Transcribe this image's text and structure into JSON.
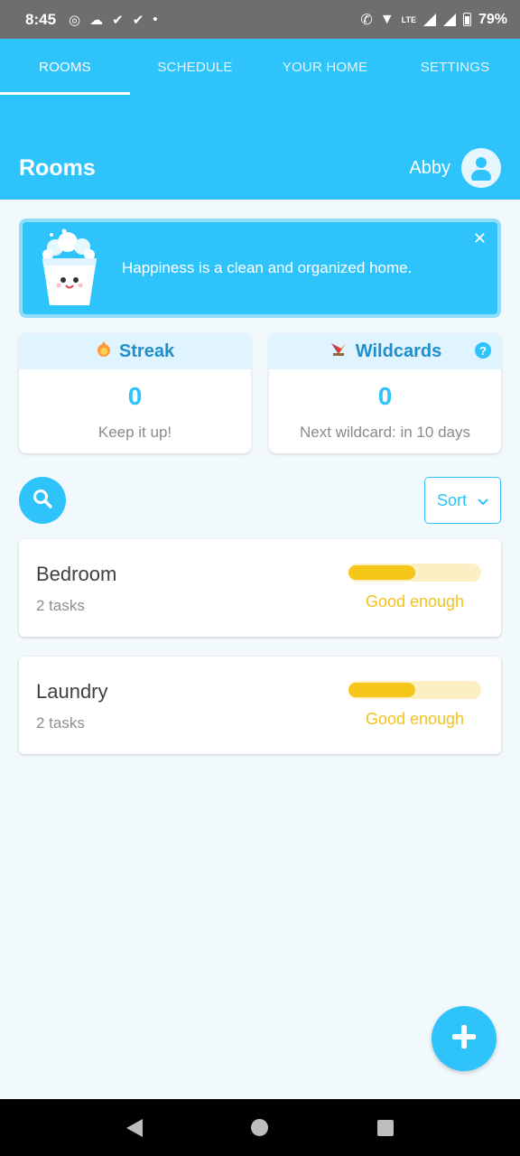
{
  "status_bar": {
    "time": "8:45",
    "network_label": "LTE",
    "battery": "79%"
  },
  "tabs": [
    {
      "label": "ROOMS",
      "active": true
    },
    {
      "label": "SCHEDULE",
      "active": false
    },
    {
      "label": "YOUR HOME",
      "active": false
    },
    {
      "label": "SETTINGS",
      "active": false
    }
  ],
  "header": {
    "title": "Rooms",
    "user_name": "Abby"
  },
  "banner": {
    "text": "Happiness is a clean and organized home.",
    "close_icon": "close-icon"
  },
  "stats": {
    "streak": {
      "label": "Streak",
      "value": "0",
      "sub": "Keep it up!"
    },
    "wildcards": {
      "label": "Wildcards",
      "value": "0",
      "sub": "Next wildcard: in 10 days",
      "help": "?"
    }
  },
  "toolbar": {
    "sort_label": "Sort"
  },
  "rooms": [
    {
      "name": "Bedroom",
      "tasks": "2 tasks",
      "status": "Good enough",
      "progress": 0.5
    },
    {
      "name": "Laundry",
      "tasks": "2 tasks",
      "status": "Good enough",
      "progress": 0.5
    }
  ],
  "colors": {
    "primary": "#2ec4fb",
    "status_yellow": "#f7c61b",
    "header_text": "#1e8fcc"
  }
}
